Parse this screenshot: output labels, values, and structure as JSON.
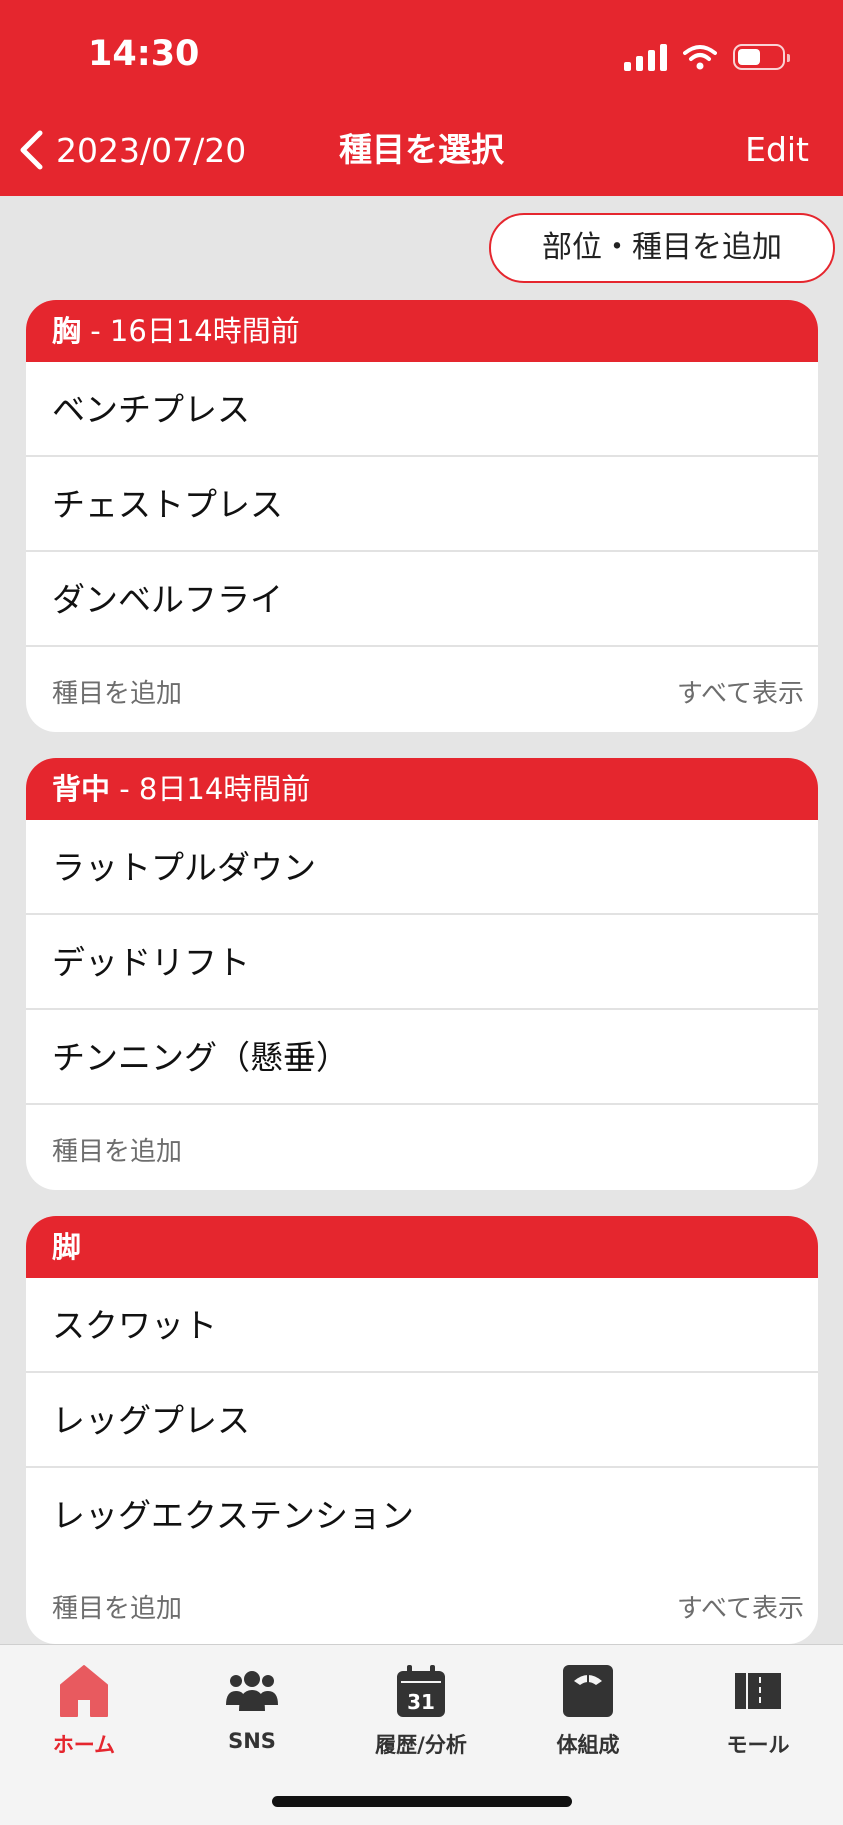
{
  "status": {
    "time": "14:30"
  },
  "nav": {
    "back_label": "2023/07/20",
    "title": "種目を選択",
    "edit_label": "Edit"
  },
  "add_part_button": "部位・種目を追加",
  "sections": [
    {
      "name": "胸",
      "since": " - 16日14時間前",
      "items": [
        "ベンチプレス",
        "チェストプレス",
        "ダンベルフライ"
      ],
      "add_label": "種目を追加",
      "show_all": "すべて表示"
    },
    {
      "name": "背中",
      "since": " - 8日14時間前",
      "items": [
        "ラットプルダウン",
        "デッドリフト",
        "チンニング（懸垂）"
      ],
      "add_label": "種目を追加"
    },
    {
      "name": "脚",
      "items": [
        "スクワット",
        "レッグプレス",
        "レッグエクステンション"
      ],
      "add_label": "種目を追加",
      "show_all": "すべて表示"
    }
  ],
  "tabbar": {
    "items": [
      {
        "label": "ホーム",
        "icon": "home-icon",
        "active": true
      },
      {
        "label": "SNS",
        "icon": "people-icon"
      },
      {
        "label": "履歴/分析",
        "icon": "calendar-icon",
        "calendar_day": "31"
      },
      {
        "label": "体組成",
        "icon": "scale-icon"
      },
      {
        "label": "モール",
        "icon": "store-icon"
      }
    ]
  },
  "colors": {
    "accent": "#e5262e",
    "background": "#e5e5e5"
  }
}
